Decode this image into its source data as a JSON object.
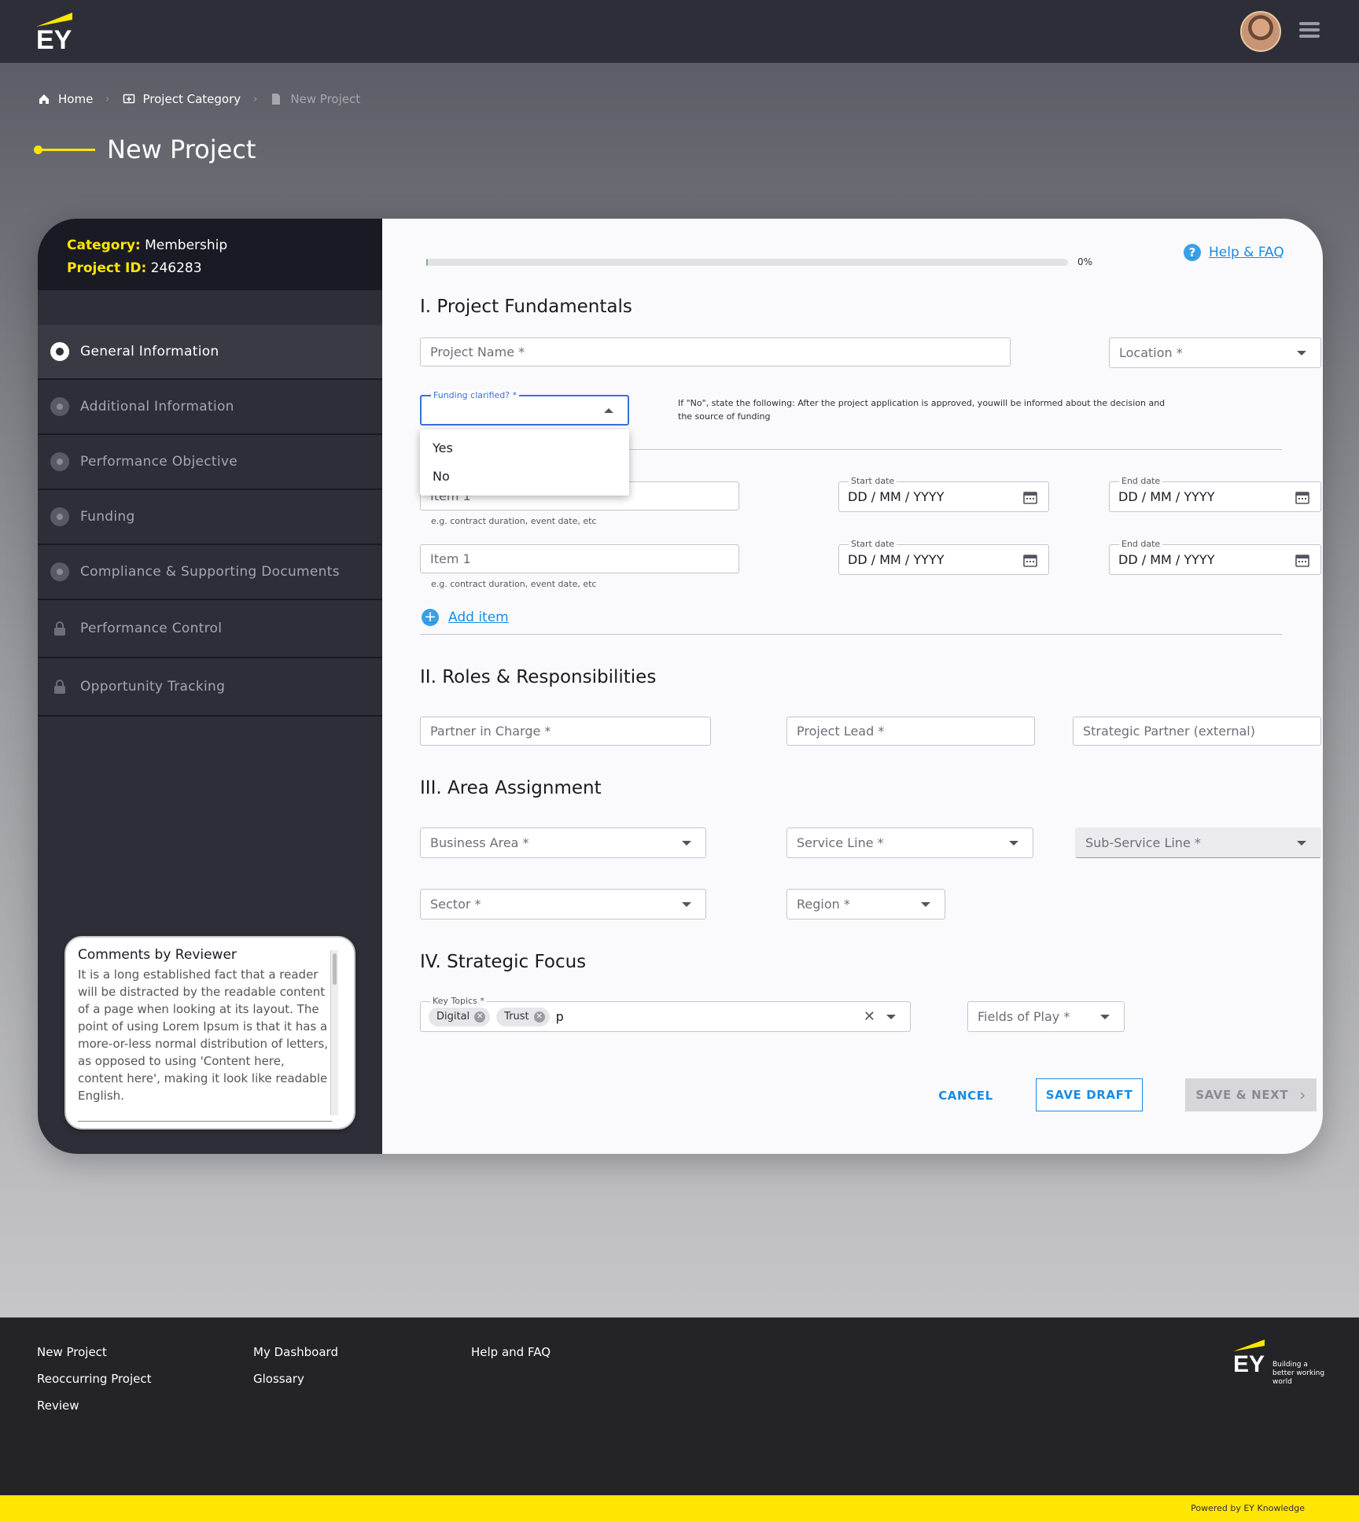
{
  "header": {
    "logo_text": "EY",
    "avatar_alt": "user-avatar",
    "menu_icon": "hamburger-menu-icon"
  },
  "breadcrumb": {
    "items": [
      {
        "label": "Home",
        "icon": "home-icon"
      },
      {
        "label": "Project Category",
        "icon": "category-icon"
      },
      {
        "label": "New Project",
        "icon": "document-icon"
      }
    ]
  },
  "page": {
    "title": "New Project"
  },
  "sidebar": {
    "category_label": "Category:",
    "category_value": "Membership",
    "project_id_label": "Project ID:",
    "project_id_value": "246283",
    "items": [
      {
        "label": "General Information",
        "state": "active"
      },
      {
        "label": "Additional Information",
        "state": "pending"
      },
      {
        "label": "Performance Objective",
        "state": "pending"
      },
      {
        "label": "Funding",
        "state": "pending"
      },
      {
        "label": "Compliance & Supporting Documents",
        "state": "pending"
      },
      {
        "label": "Performance Control",
        "state": "locked"
      },
      {
        "label": "Opportunity Tracking",
        "state": "locked"
      }
    ],
    "comments": {
      "title": "Comments by Reviewer",
      "text": "It is a long established fact that a reader will be distracted by the readable content of a page when looking at its layout. The point of using Lorem Ipsum is that it has a more-or-less normal distribution of letters, as opposed to using 'Content here, content here', making it look like readable English."
    }
  },
  "form": {
    "progress_label": "0%",
    "progress_value": 0,
    "help_label": "Help & FAQ",
    "section1": {
      "title": "I. Project Fundamentals",
      "project_name_placeholder": "Project Name *",
      "location_placeholder": "Location *",
      "funding_label": "Funding clarified? *",
      "funding_options": [
        "Yes",
        "No"
      ],
      "funding_note": "If \"No\", state the following: After the project application is approved, youwill be informed about the decision and the source of funding",
      "items": [
        {
          "item_placeholder": "Item 1",
          "hint": "e.g. contract duration, event date, etc",
          "start_label": "Start date",
          "start_value": "DD / MM / YYYY",
          "end_label": "End date",
          "end_value": "DD / MM / YYYY"
        },
        {
          "item_placeholder": "Item 1",
          "hint": "e.g. contract duration, event date, etc",
          "start_label": "Start date",
          "start_value": "DD / MM / YYYY",
          "end_label": "End date",
          "end_value": "DD / MM / YYYY"
        }
      ],
      "add_item_label": "Add item"
    },
    "section2": {
      "title": "II. Roles & Responsibilities",
      "partner_placeholder": "Partner in Charge *",
      "lead_placeholder": "Project Lead *",
      "strategic_placeholder": "Strategic Partner (external)"
    },
    "section3": {
      "title": "III. Area Assignment",
      "business_area": "Business Area *",
      "service_line": "Service Line *",
      "sub_service_line": "Sub-Service Line *",
      "sector": "Sector *",
      "region": "Region *"
    },
    "section4": {
      "title": "IV. Strategic Focus",
      "key_topics_label": "Key Topics *",
      "chips": [
        "Digital",
        "Trust"
      ],
      "key_topics_input": "p",
      "fields_of_play": "Fields of Play *"
    },
    "buttons": {
      "cancel": "CANCEL",
      "save_draft": "SAVE DRAFT",
      "save_next": "SAVE & NEXT"
    }
  },
  "footer": {
    "col1": [
      "New Project",
      "Reoccurring Project",
      "Review"
    ],
    "col2": [
      "My Dashboard",
      "Glossary"
    ],
    "col3": [
      "Help and FAQ"
    ],
    "tagline": "Building a better working world",
    "powered": "Powered by EY Knowledge"
  },
  "colors": {
    "brand_yellow": "#ffe600",
    "dark": "#2e2e38",
    "link_blue": "#188ce5"
  }
}
